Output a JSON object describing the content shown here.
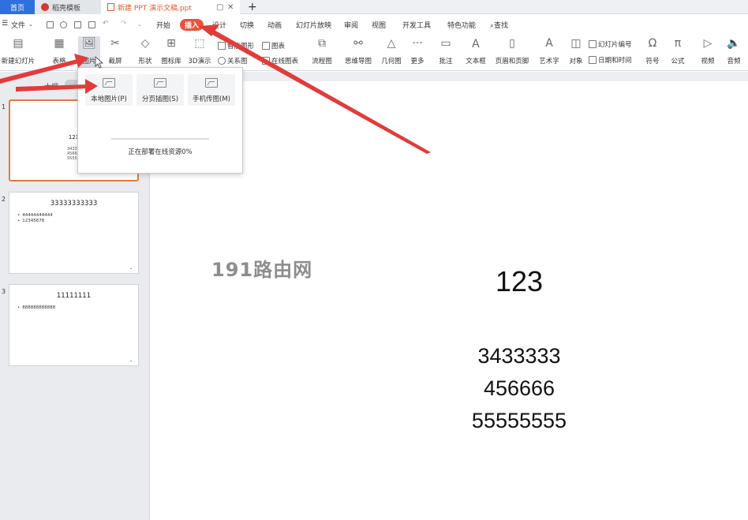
{
  "tabs": [
    {
      "label": "首页"
    },
    {
      "label": "稻壳模板"
    },
    {
      "label": "新建 PPT 演示文稿.ppt"
    }
  ],
  "menu": {
    "file": "文件",
    "items": [
      "开始",
      "插入",
      "设计",
      "切换",
      "动画",
      "幻灯片放映",
      "审阅",
      "视图",
      "开发工具",
      "特色功能"
    ],
    "active": "插入",
    "search": "查找"
  },
  "ribbon": {
    "new_slide": "新建幻灯片",
    "table": "表格",
    "picture": "图片",
    "screenshot": "截屏",
    "shape": "形状",
    "icon_lib": "图标库",
    "three_d": "3D演示",
    "smart_shape": "智能图形",
    "relation": "关系图",
    "chart": "图表",
    "online_chart": "在线图表",
    "flowchart": "流程图",
    "mindmap": "思维导图",
    "geometry": "几何图",
    "more": "更多",
    "comment": "批注",
    "textbox": "文本框",
    "header_footer": "页眉和页脚",
    "wordart": "艺术字",
    "object": "对象",
    "slide_number": "幻灯片编号",
    "datetime": "日期和时间",
    "symbol": "符号",
    "formula": "公式",
    "video": "视频",
    "audio": "音频"
  },
  "left_panel": {
    "tab_label": "大纲",
    "slides": [
      {
        "number": "1",
        "title": "123",
        "lines": [
          "3433333",
          "456666",
          "55555555"
        ]
      },
      {
        "number": "2",
        "title": "33333333333",
        "bullets": [
          "44444444444",
          "12345678"
        ]
      },
      {
        "number": "3",
        "title": "11111111",
        "bullets": [
          "888888888888"
        ]
      }
    ]
  },
  "slide": {
    "title": "123",
    "lines": [
      "3433333",
      "456666",
      "55555555"
    ]
  },
  "dropdown": {
    "options": [
      "本地图片(P)",
      "分页插图(S)",
      "手机传图(M)"
    ],
    "status": "正在部署在线资源0%",
    "progress": 0
  },
  "watermark": "191路由网",
  "colors": {
    "accent": "#e8553b",
    "arrow": "#e23b3b",
    "home_tab": "#2f6fde"
  }
}
